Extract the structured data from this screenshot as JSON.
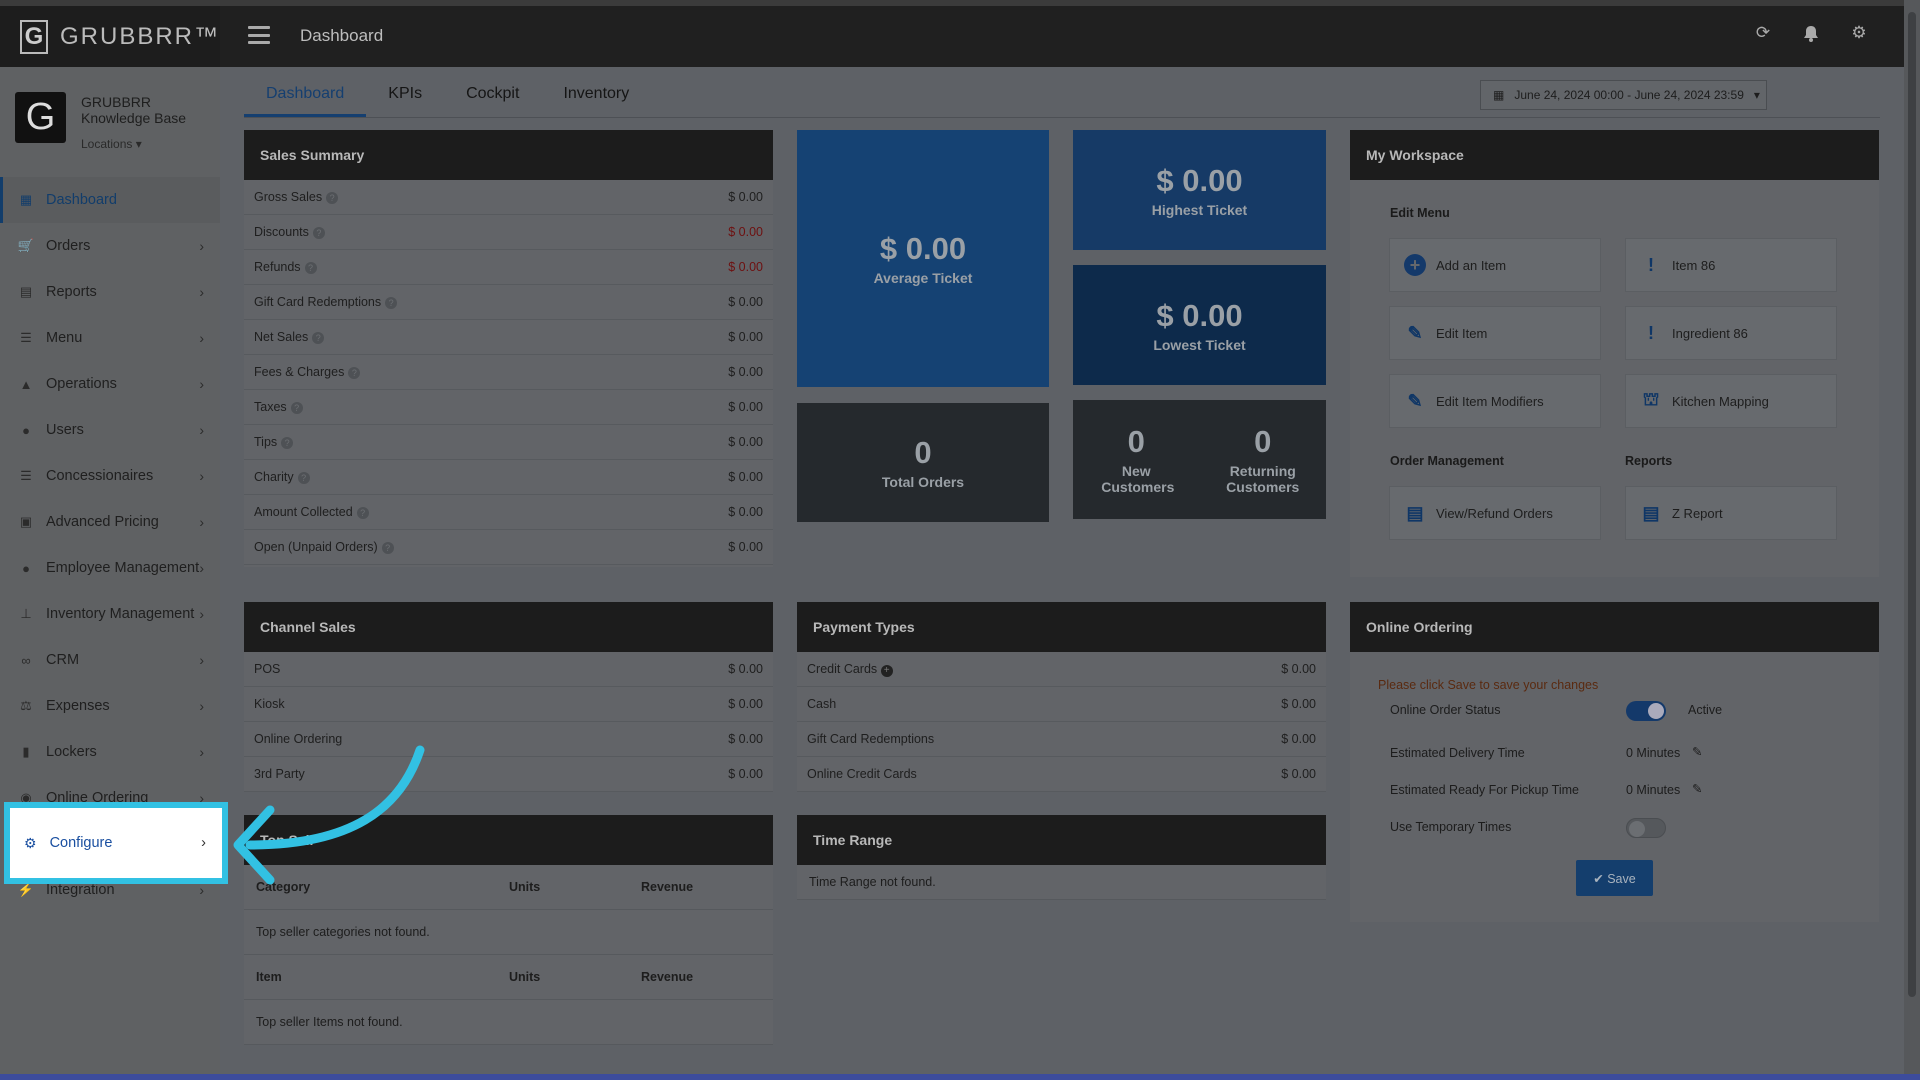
{
  "app": {
    "brand": "GRUBBRR™",
    "logo_letter": "G",
    "page_title": "Dashboard"
  },
  "profile": {
    "org_line1": "GRUBBRR",
    "org_line2": "Knowledge Base",
    "locations_label": "Locations ▾",
    "avatar_letter": "G"
  },
  "sidebar": {
    "items": [
      {
        "label": "Dashboard",
        "icon": "dashboard-icon"
      },
      {
        "label": "Orders",
        "icon": "cart-icon"
      },
      {
        "label": "Reports",
        "icon": "report-icon"
      },
      {
        "label": "Menu",
        "icon": "list-icon"
      },
      {
        "label": "Operations",
        "icon": "flask-icon"
      },
      {
        "label": "Users",
        "icon": "users-icon"
      },
      {
        "label": "Concessionaires",
        "icon": "list-icon"
      },
      {
        "label": "Advanced Pricing",
        "icon": "money-icon"
      },
      {
        "label": "Employee Management",
        "icon": "team-icon"
      },
      {
        "label": "Inventory Management",
        "icon": "sitemap-icon"
      },
      {
        "label": "CRM",
        "icon": "link-icon"
      },
      {
        "label": "Expenses",
        "icon": "scale-icon"
      },
      {
        "label": "Lockers",
        "icon": "lockers-icon"
      },
      {
        "label": "Online Ordering",
        "icon": "globe-icon"
      },
      {
        "label": "Configure",
        "icon": "gear-icon"
      },
      {
        "label": "Integration",
        "icon": "plug-icon"
      }
    ]
  },
  "tabs": [
    "Dashboard",
    "KPIs",
    "Cockpit",
    "Inventory"
  ],
  "date_range": "June 24, 2024 00:00 - June 24, 2024 23:59",
  "sales_summary": {
    "title": "Sales Summary",
    "rows": [
      {
        "label": "Gross Sales",
        "value": "$ 0.00"
      },
      {
        "label": "Discounts",
        "value": "$ 0.00"
      },
      {
        "label": "Refunds",
        "value": "$ 0.00"
      },
      {
        "label": "Gift Card Redemptions",
        "value": "$ 0.00"
      },
      {
        "label": "Net Sales",
        "value": "$ 0.00"
      },
      {
        "label": "Fees & Charges",
        "value": "$ 0.00"
      },
      {
        "label": "Taxes",
        "value": "$ 0.00"
      },
      {
        "label": "Tips",
        "value": "$ 0.00"
      },
      {
        "label": "Charity",
        "value": "$ 0.00"
      },
      {
        "label": "Amount Collected",
        "value": "$ 0.00"
      },
      {
        "label": "Open (Unpaid Orders)",
        "value": "$ 0.00"
      }
    ]
  },
  "stats": {
    "average": {
      "value": "$ 0.00",
      "label": "Average Ticket"
    },
    "highest": {
      "value": "$ 0.00",
      "label": "Highest Ticket"
    },
    "lowest": {
      "value": "$ 0.00",
      "label": "Lowest Ticket"
    },
    "total_orders": {
      "value": "0",
      "label": "Total Orders"
    },
    "new_customers": {
      "value": "0",
      "label": "New Customers"
    },
    "returning_customers": {
      "value": "0",
      "label": "Returning Customers"
    }
  },
  "workspace": {
    "title": "My Workspace",
    "edit_menu_label": "Edit Menu",
    "order_mgmt_label": "Order Management",
    "reports_label": "Reports",
    "buttons": {
      "add_item": "Add an Item",
      "item86": "Item 86",
      "edit_item": "Edit Item",
      "ingredient86": "Ingredient 86",
      "edit_modifiers": "Edit Item Modifiers",
      "kitchen_mapping": "Kitchen Mapping",
      "view_refund": "View/Refund Orders",
      "z_report": "Z Report"
    }
  },
  "channel_sales": {
    "title": "Channel Sales",
    "rows": [
      {
        "label": "POS",
        "value": "$ 0.00"
      },
      {
        "label": "Kiosk",
        "value": "$ 0.00"
      },
      {
        "label": "Online Ordering",
        "value": "$ 0.00"
      },
      {
        "label": "3rd Party",
        "value": "$ 0.00"
      }
    ]
  },
  "payment_types": {
    "title": "Payment Types",
    "rows": [
      {
        "label": "Credit Cards",
        "value": "$ 0.00"
      },
      {
        "label": "Cash",
        "value": "$ 0.00"
      },
      {
        "label": "Gift Card Redemptions",
        "value": "$ 0.00"
      },
      {
        "label": "Online Credit Cards",
        "value": "$ 0.00"
      }
    ]
  },
  "online_ordering": {
    "title": "Online Ordering",
    "notice": "Please click Save to save your changes",
    "status_label": "Online Order Status",
    "status_value": "Active",
    "delivery_label": "Estimated Delivery Time",
    "delivery_value": "0 Minutes",
    "pickup_label": "Estimated Ready For Pickup Time",
    "pickup_value": "0 Minutes",
    "temp_label": "Use Temporary Times",
    "save_label": "✔ Save"
  },
  "top_sellers": {
    "title": "Top Sell",
    "cat_headers": [
      "Category",
      "Units",
      "Revenue"
    ],
    "cat_empty": "Top seller categories not found.",
    "item_headers": [
      "Item",
      "Units",
      "Revenue"
    ],
    "item_empty": "Top seller Items not found."
  },
  "time_range": {
    "title": "Time Range",
    "empty": "Time Range not found."
  },
  "colors": {
    "highlight": "#32c1e3",
    "accent": "#153f70"
  }
}
